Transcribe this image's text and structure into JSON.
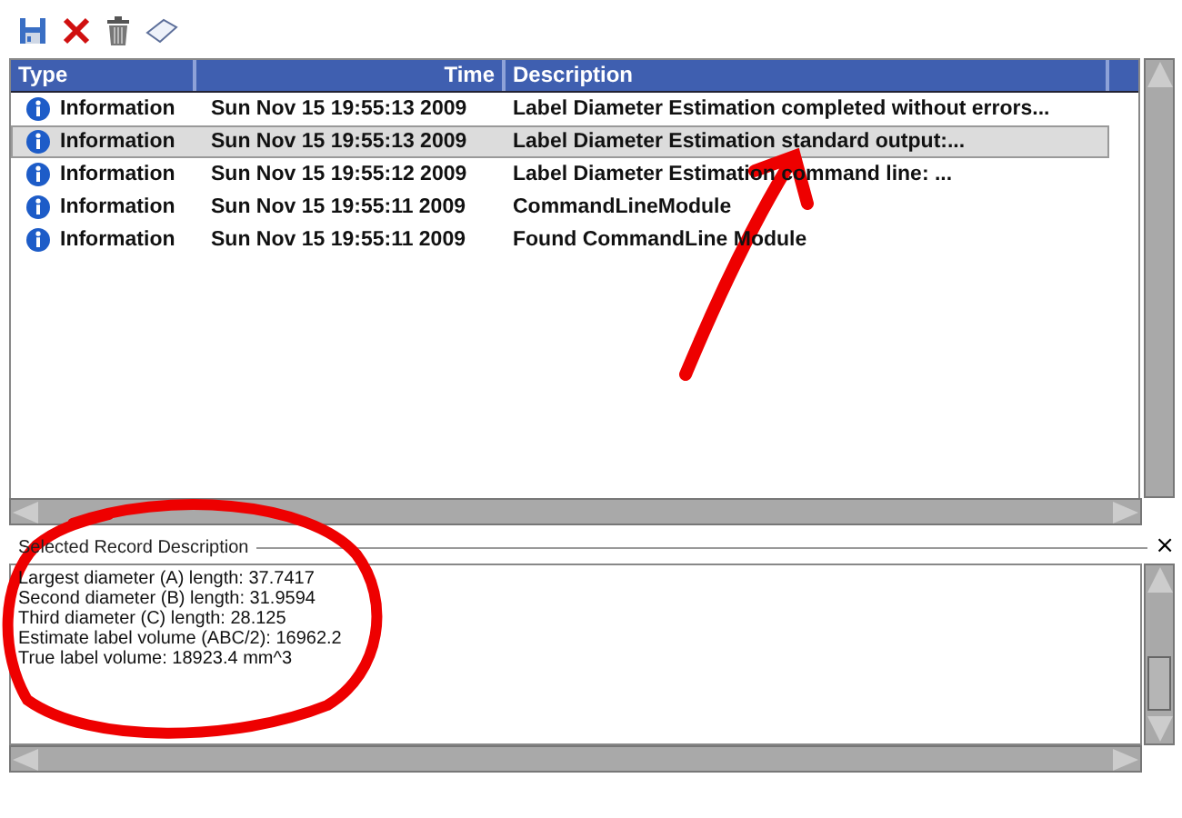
{
  "toolbar": [
    {
      "kind": "save"
    },
    {
      "kind": "delete"
    },
    {
      "kind": "trash"
    },
    {
      "kind": "clear"
    }
  ],
  "table": {
    "columns": [
      {
        "label": "Type"
      },
      {
        "label": "Time"
      },
      {
        "label": "Description"
      }
    ],
    "rows": [
      {
        "type": "Information",
        "time": "Sun Nov 15 19:55:13 2009",
        "description": "Label Diameter Estimation completed without errors...",
        "selected": false
      },
      {
        "type": "Information",
        "time": "Sun Nov 15 19:55:13 2009",
        "description": "Label Diameter Estimation standard output:...",
        "selected": true
      },
      {
        "type": "Information",
        "time": "Sun Nov 15 19:55:12 2009",
        "description": "Label Diameter Estimation command line: ...",
        "selected": false
      },
      {
        "type": "Information",
        "time": "Sun Nov 15 19:55:11 2009",
        "description": "CommandLineModule",
        "selected": false
      },
      {
        "type": "Information",
        "time": "Sun Nov 15 19:55:11 2009",
        "description": "Found CommandLine Module",
        "selected": false
      }
    ]
  },
  "details": {
    "title": "Selected Record Description",
    "close": "×",
    "lines": [
      "Largest diameter (A) length: 37.7417",
      "Second diameter (B) length: 31.9594",
      "Third diameter (C) length: 28.125",
      "Estimate label volume (ABC/2): 16962.2",
      "True label volume: 18923.4 mm^3"
    ]
  },
  "annotations": {
    "arrow": {
      "color": "#ee0000"
    },
    "circle": {
      "color": "#ee0000"
    }
  }
}
